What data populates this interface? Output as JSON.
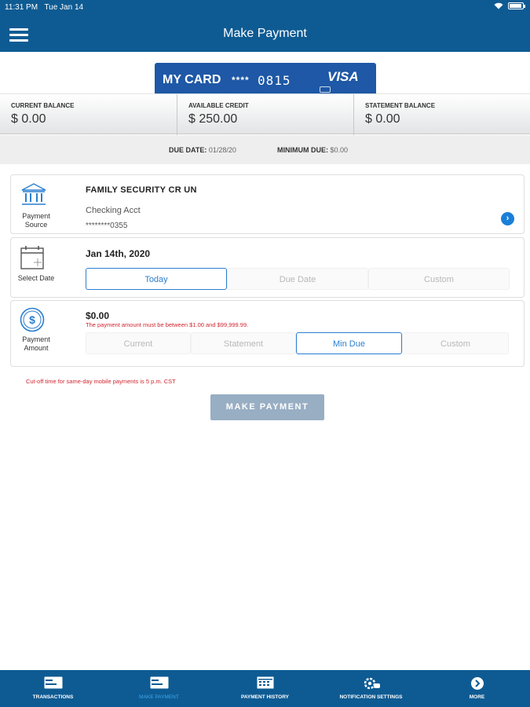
{
  "status_bar": {
    "time": "11:31 PM",
    "date": "Tue Jan 14"
  },
  "header": {
    "title": "Make Payment"
  },
  "card": {
    "name": "MY CARD",
    "mask": "****",
    "last4": "0815",
    "brand": "VISA"
  },
  "balances": [
    {
      "label": "CURRENT BALANCE",
      "value": "$ 0.00"
    },
    {
      "label": "AVAILABLE CREDIT",
      "value": "$ 250.00"
    },
    {
      "label": "STATEMENT BALANCE",
      "value": "$ 0.00"
    }
  ],
  "due": {
    "due_label": "DUE DATE:",
    "due_value": "01/28/20",
    "min_label": "MINIMUM DUE:",
    "min_value": "$0.00"
  },
  "payment_source": {
    "label": "Payment Source",
    "institution": "FAMILY SECURITY CR UN",
    "account_type": "Checking Acct",
    "account_number": "********0355"
  },
  "select_date": {
    "label": "Select Date",
    "value": "Jan 14th, 2020",
    "options": [
      "Today",
      "Due Date",
      "Custom"
    ],
    "selected": "Today"
  },
  "payment_amount": {
    "label": "Payment Amount",
    "value": "$0.00",
    "error": "The payment amount must be between $1.00 and $99,999.99.",
    "options": [
      "Current",
      "Statement",
      "Min Due",
      "Custom"
    ],
    "selected": "Min Due"
  },
  "cutoff_notice": "Cut-off time for same-day mobile payments is 5 p.m. CST",
  "make_payment_label": "MAKE PAYMENT",
  "bottom_nav": [
    {
      "label": "TRANSACTIONS",
      "icon": "card-icon"
    },
    {
      "label": "MAKE PAYMENT",
      "icon": "card-icon",
      "active": true
    },
    {
      "label": "PAYMENT HISTORY",
      "icon": "calendar-icon"
    },
    {
      "label": "NOTIFICATION SETTINGS",
      "icon": "gear-bubble-icon"
    },
    {
      "label": "MORE",
      "icon": "chevron-circle-icon"
    }
  ],
  "colors": {
    "header": "#0e5b93",
    "accent": "#2a7fd0",
    "error": "#d0262f",
    "card": "#1e58a6",
    "button_disabled": "#98aec3"
  }
}
